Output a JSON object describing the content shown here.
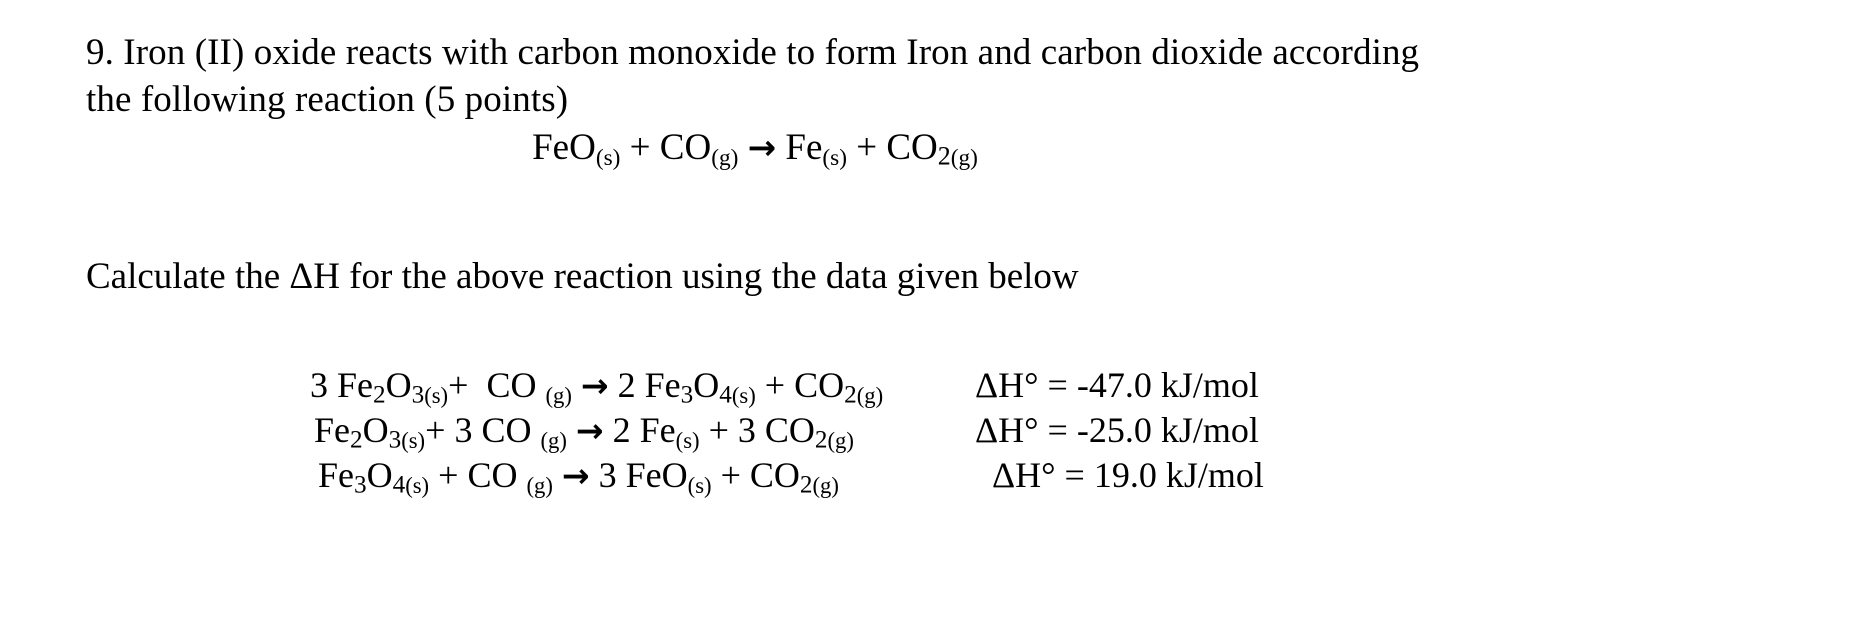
{
  "document": {
    "question_number": "9.",
    "intro_line_1": "9. Iron (II) oxide reacts with carbon monoxide to form Iron and carbon dioxide according",
    "intro_line_2": "the following reaction (5 points)",
    "main_equation": "FeO (s) + CO (g) → Fe (s) + CO2 (g)",
    "instruction": "Calculate the ΔH for the above reaction using the data given below",
    "arrow_glyph": "→",
    "delta_h_symbol": "ΔH°",
    "text_color": "#000000",
    "background_color": "#ffffff"
  },
  "main_equation_parts": {
    "reactant_1": "FeO",
    "reactant_1_state": "(s)",
    "plus_1": "+",
    "reactant_2": "CO",
    "reactant_2_state": "(g)",
    "arrow": "→",
    "product_1": "Fe",
    "product_1_state": "(s)",
    "plus_2": "+",
    "product_2": "CO",
    "product_2_sub": "2",
    "product_2_state": "(g)"
  },
  "data_equations": [
    {
      "coeff_r1": "3 ",
      "r1_formula": "Fe",
      "r1_sub1": "2",
      "r1_mid": "O",
      "r1_sub2": "3",
      "r1_state": "(s)",
      "plus_1": "+",
      "coeff_r2": " ",
      "r2_formula": "CO",
      "r2_state": "(g)",
      "arrow": "→",
      "coeff_p1": "2 ",
      "p1_formula": "Fe",
      "p1_sub1": "3",
      "p1_mid": "O",
      "p1_sub2": "4",
      "p1_state": "(s)",
      "plus_2": "+",
      "coeff_p2": " ",
      "p2_formula": "CO",
      "p2_sub": "2",
      "p2_state": "(g)",
      "enthalpy_label": "ΔH°",
      "enthalpy_equals": "=",
      "enthalpy_value": "-47.0 kJ/mol"
    },
    {
      "coeff_r1": "",
      "r1_formula": "Fe",
      "r1_sub1": "2",
      "r1_mid": "O",
      "r1_sub2": "3",
      "r1_state": "(s)",
      "plus_1": "+",
      "coeff_r2": "3 ",
      "r2_formula": "CO",
      "r2_state": "(g)",
      "arrow": "→",
      "coeff_p1": "2 ",
      "p1_formula": "Fe",
      "p1_sub1": "",
      "p1_mid": "",
      "p1_sub2": "",
      "p1_state": "(s)",
      "plus_2": "+",
      "coeff_p2": "3 ",
      "p2_formula": "CO",
      "p2_sub": "2",
      "p2_state": "(g)",
      "enthalpy_label": "ΔH°",
      "enthalpy_equals": "=",
      "enthalpy_value": "-25.0 kJ/mol"
    },
    {
      "coeff_r1": "",
      "r1_formula": "Fe",
      "r1_sub1": "3",
      "r1_mid": "O",
      "r1_sub2": "4",
      "r1_state": "(s)",
      "plus_1": "+",
      "coeff_r2": "",
      "r2_formula": "CO",
      "r2_state": "(g)",
      "arrow": "→",
      "coeff_p1": "3 ",
      "p1_formula": "FeO",
      "p1_sub1": "",
      "p1_mid": "",
      "p1_sub2": "",
      "p1_state": "(s)",
      "plus_2": "+",
      "coeff_p2": "",
      "p2_formula": "CO",
      "p2_sub": "2",
      "p2_state": "(g)",
      "enthalpy_label": "ΔH°",
      "enthalpy_equals": "=",
      "enthalpy_value": "19.0 kJ/mol"
    }
  ]
}
